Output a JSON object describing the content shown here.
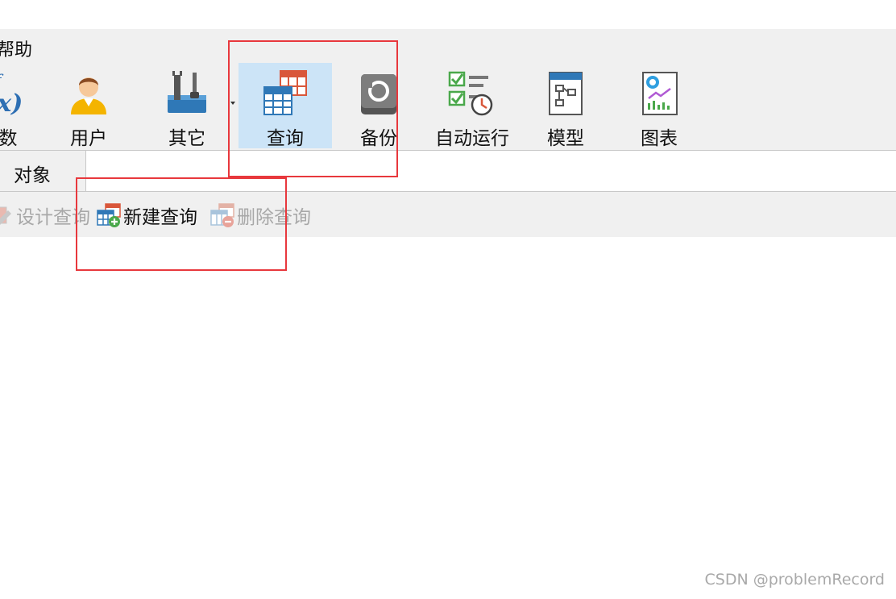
{
  "menu": {
    "help_label": "帮助"
  },
  "toolbar": {
    "function_label": "数",
    "user_label": "用户",
    "other_label": "其它",
    "query_label": "查询",
    "backup_label": "备份",
    "automation_label": "自动运行",
    "model_label": "模型",
    "chart_label": "图表",
    "active_tool": "查询"
  },
  "object_tab": {
    "label": "对象"
  },
  "actions": {
    "design_label": "设计查询",
    "new_label": "新建查询",
    "delete_label": "删除查询"
  },
  "watermark": "CSDN @problemRecord",
  "colors": {
    "highlight_box": "#e8383d",
    "active_tool_bg": "#cce4f7",
    "toolbar_bg": "#f0f0f0"
  }
}
